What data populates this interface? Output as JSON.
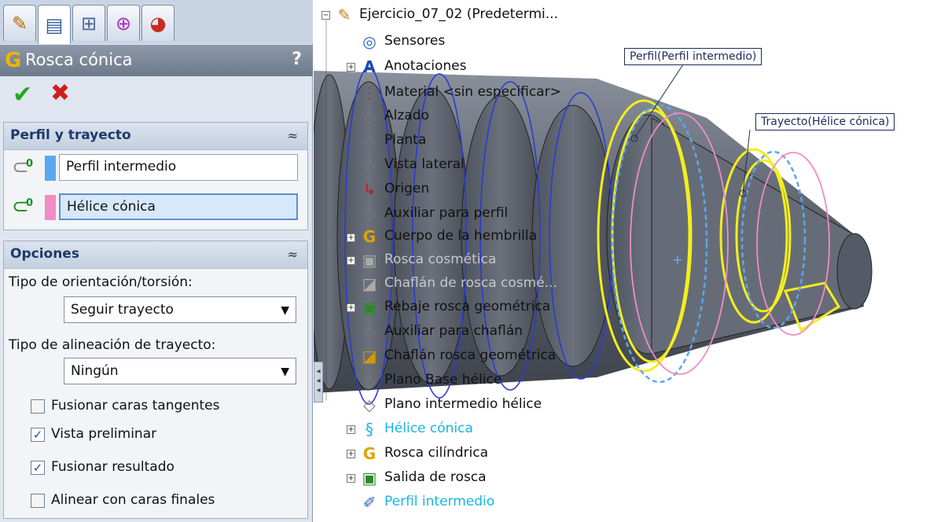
{
  "tabs": [
    {
      "icon": "feature-manager-icon"
    },
    {
      "icon": "property-manager-icon"
    },
    {
      "icon": "configuration-manager-icon"
    },
    {
      "icon": "dimxpert-icon"
    },
    {
      "icon": "display-manager-icon"
    }
  ],
  "property_manager": {
    "title": "Rosca cónica",
    "help": "?",
    "profile_group": {
      "title": "Perfil y trayecto",
      "profile_value": "Perfil intermedio",
      "path_value": "Hélice cónica",
      "profile_color": "#5ba7f2",
      "path_color": "#f08cc6"
    },
    "options_group": {
      "title": "Opciones",
      "orientation_label": "Tipo de orientación/torsión:",
      "orientation_value": "Seguir trayecto",
      "alignment_label": "Tipo de alineación de trayecto:",
      "alignment_value": "Ningún",
      "checks": [
        {
          "label": "Fusionar caras tangentes",
          "checked": false
        },
        {
          "label": "Vista preliminar",
          "checked": true
        },
        {
          "label": "Fusionar resultado",
          "checked": true
        },
        {
          "label": "Alinear con caras finales",
          "checked": false
        }
      ]
    }
  },
  "tree": {
    "root": "Ejercicio_07_02  (Predetermi...",
    "items": [
      {
        "label": "Sensores",
        "icon": "sensor-icon"
      },
      {
        "label": "Anotaciones",
        "icon": "annotations-icon"
      },
      {
        "label": "Material <sin especificar>",
        "icon": "material-icon"
      },
      {
        "label": "Alzado",
        "icon": "plane-icon"
      },
      {
        "label": "Planta",
        "icon": "plane-icon"
      },
      {
        "label": "Vista lateral",
        "icon": "plane-icon"
      },
      {
        "label": "Origen",
        "icon": "origin-icon"
      },
      {
        "label": "Auxiliar para perfil",
        "icon": "plane-icon"
      },
      {
        "label": "Cuerpo de la hembrilla",
        "icon": "revolve-icon"
      },
      {
        "label": "Rosca cosmética",
        "icon": "cosmetic-thread-icon"
      },
      {
        "label": "Chaflán de rosca cosmé...",
        "icon": "chamfer-icon"
      },
      {
        "label": "Rebaje rosca geométrica",
        "icon": "cut-icon"
      },
      {
        "label": "Auxiliar para chaflán",
        "icon": "plane-icon"
      },
      {
        "label": "Chaflán rosca geométrica",
        "icon": "chamfer-icon"
      },
      {
        "label": "Plano  Base hélice",
        "icon": "plane-icon"
      },
      {
        "label": "Plano intermedio hélice",
        "icon": "plane-icon"
      },
      {
        "label": "Hélice cónica",
        "icon": "helix-icon"
      },
      {
        "label": "Rosca cilíndrica",
        "icon": "sweep-icon"
      },
      {
        "label": "Salida de rosca",
        "icon": "cut-icon"
      },
      {
        "label": "Perfil intermedio",
        "icon": "sketch-icon"
      }
    ]
  },
  "callouts": {
    "profile": "Perfil(Perfil intermedio)",
    "path": "Trayecto(Hélice cónica)"
  },
  "colors": {
    "accent_yellow": "#f4ee1e",
    "helix_blue": "#17b3e6",
    "part_gray": "#5f6673"
  }
}
